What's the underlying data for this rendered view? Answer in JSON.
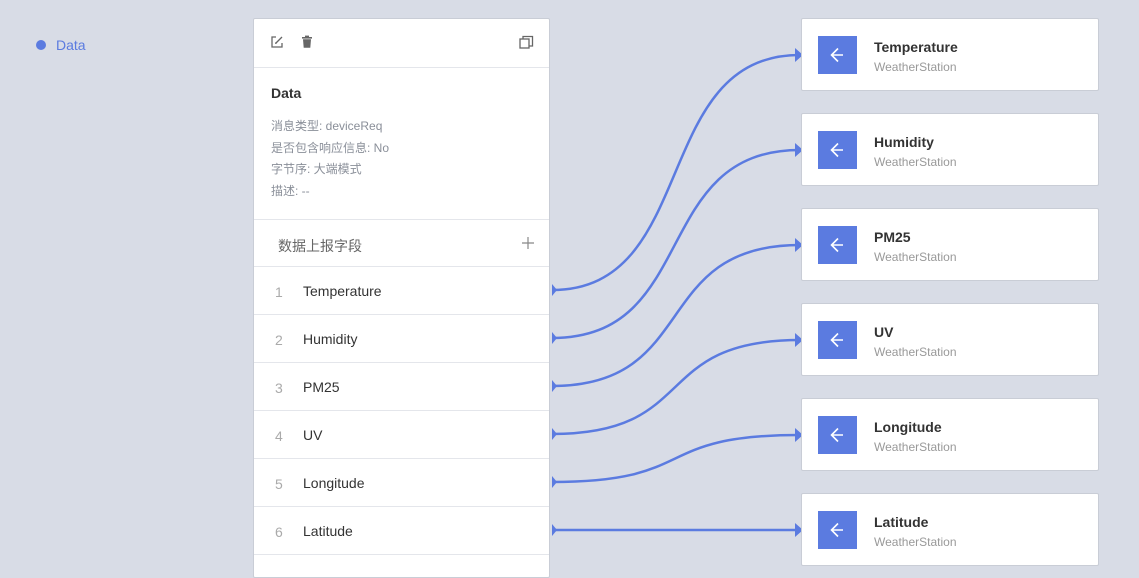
{
  "legend": {
    "label": "Data"
  },
  "panel": {
    "title": "Data",
    "info": [
      "消息类型: deviceReq",
      "是否包含响应信息: No",
      "字节序: 大端模式",
      "描述: --"
    ],
    "section_label": "数据上报字段",
    "fields": [
      {
        "index": "1",
        "name": "Temperature"
      },
      {
        "index": "2",
        "name": "Humidity"
      },
      {
        "index": "3",
        "name": "PM25"
      },
      {
        "index": "4",
        "name": "UV"
      },
      {
        "index": "5",
        "name": "Longitude"
      },
      {
        "index": "6",
        "name": "Latitude"
      }
    ]
  },
  "targets": [
    {
      "name": "Temperature",
      "source": "WeatherStation"
    },
    {
      "name": "Humidity",
      "source": "WeatherStation"
    },
    {
      "name": "PM25",
      "source": "WeatherStation"
    },
    {
      "name": "UV",
      "source": "WeatherStation"
    },
    {
      "name": "Longitude",
      "source": "WeatherStation"
    },
    {
      "name": "Latitude",
      "source": "WeatherStation"
    }
  ],
  "colors": {
    "accent": "#5b7be0",
    "background": "#d8dce6"
  },
  "icons": {
    "edit": "edit-icon",
    "delete": "trash-icon",
    "window": "restore-window-icon",
    "add": "plus-icon",
    "target": "arrow-left-box-icon"
  }
}
